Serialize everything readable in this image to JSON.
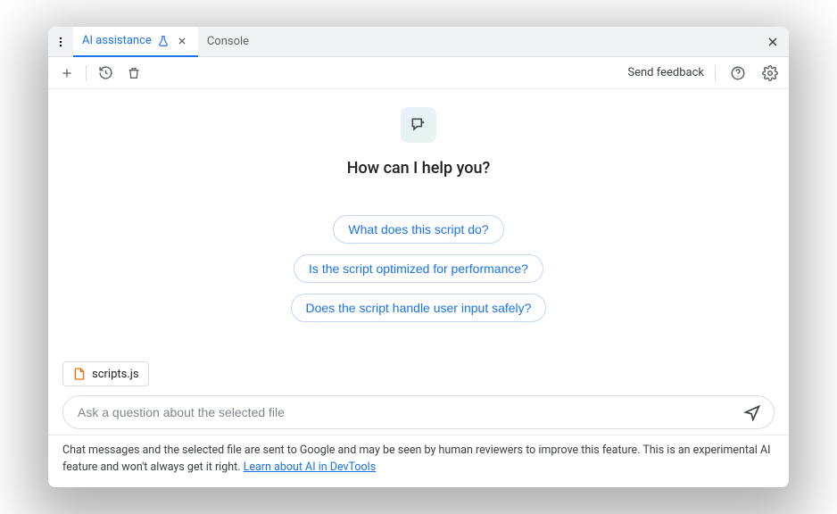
{
  "tabs": {
    "active": {
      "label": "AI assistance"
    },
    "secondary": {
      "label": "Console"
    }
  },
  "toolbar": {
    "feedback_label": "Send feedback"
  },
  "hero": {
    "title": "How can I help you?"
  },
  "suggestions": [
    "What does this script do?",
    "Is the script optimized for performance?",
    "Does the script handle user input safely?"
  ],
  "selected_file": {
    "name": "scripts.js"
  },
  "input": {
    "placeholder": "Ask a question about the selected file"
  },
  "disclaimer": {
    "text": "Chat messages and the selected file are sent to Google and may be seen by human reviewers to improve this feature. This is an experimental AI feature and won't always get it right. ",
    "link_text": "Learn about AI in DevTools"
  }
}
